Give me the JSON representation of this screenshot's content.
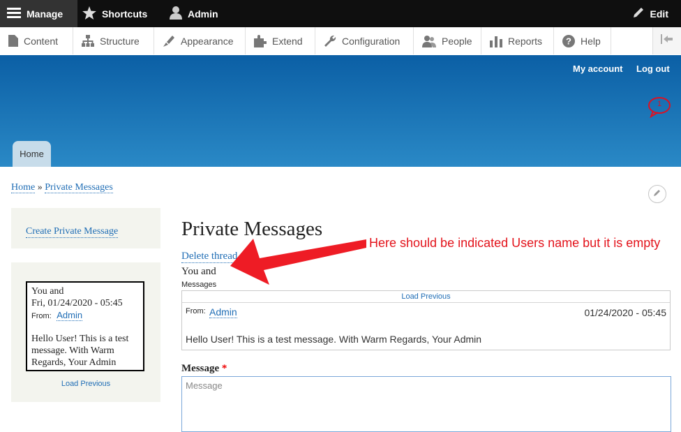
{
  "toolbar": {
    "manage": "Manage",
    "shortcuts": "Shortcuts",
    "admin": "Admin",
    "edit": "Edit"
  },
  "tray": {
    "items": [
      {
        "label": "Content",
        "icon": "document-icon"
      },
      {
        "label": "Structure",
        "icon": "sitemap-icon"
      },
      {
        "label": "Appearance",
        "icon": "paintbrush-icon"
      },
      {
        "label": "Extend",
        "icon": "puzzle-icon"
      },
      {
        "label": "Configuration",
        "icon": "wrench-icon"
      },
      {
        "label": "People",
        "icon": "people-icon"
      },
      {
        "label": "Reports",
        "icon": "bar-chart-icon"
      },
      {
        "label": "Help",
        "icon": "help-icon"
      }
    ]
  },
  "header": {
    "my_account": "My account",
    "log_out": "Log out",
    "notification_count": "1",
    "home_tab": "Home"
  },
  "breadcrumb": {
    "home": "Home",
    "separator": "»",
    "current": "Private Messages"
  },
  "sidebar": {
    "create_link": "Create Private Message",
    "card": {
      "title": "You and",
      "date": "Fri, 01/24/2020 - 05:45",
      "from_label": "From:",
      "from_name": "Admin",
      "body": "Hello User! This is a test message. With Warm Regards, Your Admin"
    },
    "load_previous": "Load Previous"
  },
  "main": {
    "title": "Private Messages",
    "delete_thread": "Delete thread",
    "you_and": "You and",
    "messages_label": "Messages",
    "thread": {
      "load_previous": "Load Previous",
      "from_label": "From:",
      "from_name": "Admin",
      "date": "01/24/2020 - 05:45",
      "body": "Hello User! This is a test message. With Warm Regards, Your Admin"
    },
    "message_label": "Message",
    "required_mark": "*",
    "message_placeholder": "Message"
  },
  "annotation": {
    "text": "Here should be indicated Users name but it is empty",
    "color": "#e3131b"
  },
  "colors": {
    "toolbar_bg": "#0f0f0f",
    "header_top": "#0b5fa5",
    "header_bottom": "#2a89c6",
    "link": "#1f6db5"
  }
}
